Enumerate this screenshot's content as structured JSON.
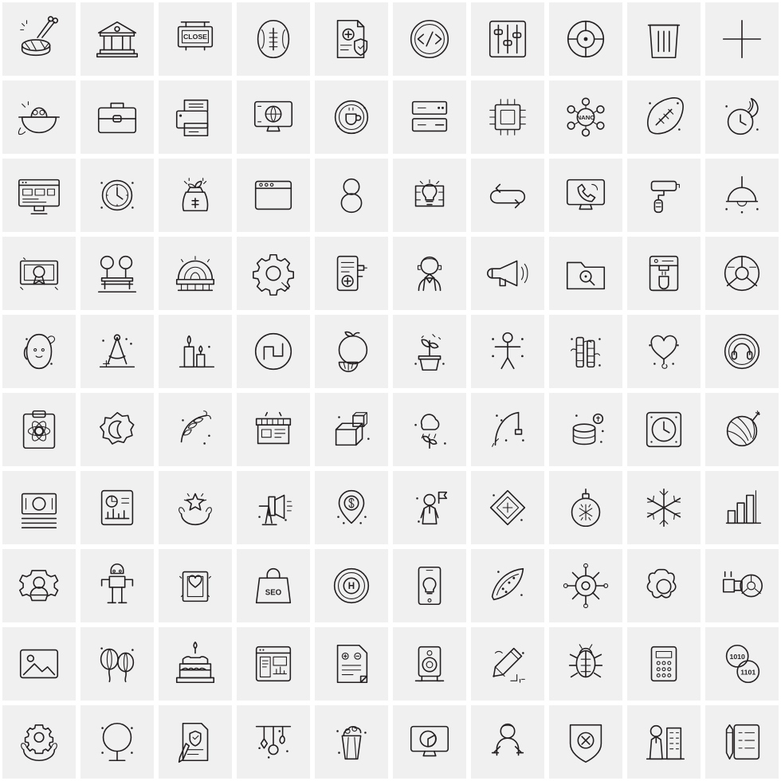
{
  "page": {
    "title": "Line Icon Set Sheet",
    "columns": 10,
    "rows": 10,
    "cell_size_px": 98,
    "icon_style": "thin line / outline",
    "stroke_color": "#231f20",
    "cell_background": "#f0f0f0",
    "sheet_background": "#ffffff"
  },
  "labels": {
    "close_sign": "CLOSE",
    "nano_molecule": "NANO",
    "seo_bag": "SEO",
    "hospital_coin": "H"
  },
  "icons": [
    {
      "row": 1,
      "col": 1,
      "name": "drum-icon",
      "label": "Drum"
    },
    {
      "row": 1,
      "col": 2,
      "name": "bank-building-icon",
      "label": "Bank Building"
    },
    {
      "row": 1,
      "col": 3,
      "name": "close-sign-icon",
      "label": "Close Sign"
    },
    {
      "row": 1,
      "col": 4,
      "name": "american-football-icon",
      "label": "American Football"
    },
    {
      "row": 1,
      "col": 5,
      "name": "medical-report-shield-icon",
      "label": "Medical Report"
    },
    {
      "row": 1,
      "col": 6,
      "name": "code-circle-icon",
      "label": "Coding"
    },
    {
      "row": 1,
      "col": 7,
      "name": "settings-sliders-icon",
      "label": "Settings Sliders"
    },
    {
      "row": 1,
      "col": 8,
      "name": "target-icon",
      "label": "Target"
    },
    {
      "row": 1,
      "col": 9,
      "name": "trash-bin-icon",
      "label": "Trash Bin"
    },
    {
      "row": 1,
      "col": 10,
      "name": "plus-icon",
      "label": "Plus"
    },
    {
      "row": 2,
      "col": 1,
      "name": "rice-bowl-icon",
      "label": "Rice Bowl"
    },
    {
      "row": 2,
      "col": 2,
      "name": "briefcase-icon",
      "label": "Briefcase"
    },
    {
      "row": 2,
      "col": 3,
      "name": "printer-icon",
      "label": "Printer"
    },
    {
      "row": 2,
      "col": 4,
      "name": "monitor-globe-icon",
      "label": "Global Monitor"
    },
    {
      "row": 2,
      "col": 5,
      "name": "coffee-badge-icon",
      "label": "Coffee Badge"
    },
    {
      "row": 2,
      "col": 6,
      "name": "server-remove-icon",
      "label": "Remove Server"
    },
    {
      "row": 2,
      "col": 7,
      "name": "microchip-icon",
      "label": "Microchip"
    },
    {
      "row": 2,
      "col": 8,
      "name": "nano-molecule-icon",
      "label": "Nano Molecule"
    },
    {
      "row": 2,
      "col": 9,
      "name": "rugby-ball-icon",
      "label": "Rugby Ball"
    },
    {
      "row": 2,
      "col": 10,
      "name": "fire-clock-icon",
      "label": "Burning Clock"
    },
    {
      "row": 3,
      "col": 1,
      "name": "desktop-layout-icon",
      "label": "Desktop Layout"
    },
    {
      "row": 3,
      "col": 2,
      "name": "wall-clock-icon",
      "label": "Wall Clock"
    },
    {
      "row": 3,
      "col": 3,
      "name": "money-plant-bag-icon",
      "label": "Money Growth Bag"
    },
    {
      "row": 3,
      "col": 4,
      "name": "browser-window-icon",
      "label": "Browser Window"
    },
    {
      "row": 3,
      "col": 5,
      "name": "number-eight-icon",
      "label": "Number Eight"
    },
    {
      "row": 3,
      "col": 6,
      "name": "idea-bulb-map-icon",
      "label": "Idea Location"
    },
    {
      "row": 3,
      "col": 7,
      "name": "refresh-loop-icon",
      "label": "Refresh Loop"
    },
    {
      "row": 3,
      "col": 8,
      "name": "monitor-call-icon",
      "label": "Online Call"
    },
    {
      "row": 3,
      "col": 9,
      "name": "paint-roller-icon",
      "label": "Paint Roller"
    },
    {
      "row": 3,
      "col": 10,
      "name": "hanging-lamp-icon",
      "label": "Hanging Lamp"
    },
    {
      "row": 4,
      "col": 1,
      "name": "certificate-award-icon",
      "label": "Certificate Award"
    },
    {
      "row": 4,
      "col": 2,
      "name": "park-bench-icon",
      "label": "Park Bench"
    },
    {
      "row": 4,
      "col": 3,
      "name": "stadium-icon",
      "label": "Stadium"
    },
    {
      "row": 4,
      "col": 4,
      "name": "gear-settings-icon",
      "label": "Gear Settings"
    },
    {
      "row": 4,
      "col": 5,
      "name": "medical-device-icon",
      "label": "Medical Device"
    },
    {
      "row": 4,
      "col": 6,
      "name": "support-agent-icon",
      "label": "Support Agent"
    },
    {
      "row": 4,
      "col": 7,
      "name": "megaphone-icon",
      "label": "Megaphone"
    },
    {
      "row": 4,
      "col": 8,
      "name": "folder-search-icon",
      "label": "Search Folder"
    },
    {
      "row": 4,
      "col": 9,
      "name": "coffee-machine-icon",
      "label": "Coffee Machine"
    },
    {
      "row": 4,
      "col": 10,
      "name": "steering-wheel-icon",
      "label": "Steering Wheel"
    },
    {
      "row": 5,
      "col": 1,
      "name": "baby-sling-icon",
      "label": "Baby Carrier"
    },
    {
      "row": 5,
      "col": 2,
      "name": "drafting-compass-icon",
      "label": "Drafting Compass"
    },
    {
      "row": 5,
      "col": 3,
      "name": "candle-icon",
      "label": "Candle"
    },
    {
      "row": 5,
      "col": 4,
      "name": "square-wave-circle-icon",
      "label": "Square Wave"
    },
    {
      "row": 5,
      "col": 5,
      "name": "orange-fruit-icon",
      "label": "Orange Fruit"
    },
    {
      "row": 5,
      "col": 6,
      "name": "potted-plant-icon",
      "label": "Potted Plant"
    },
    {
      "row": 5,
      "col": 7,
      "name": "body-stretch-icon",
      "label": "Body Stretch"
    },
    {
      "row": 5,
      "col": 8,
      "name": "bamboo-icon",
      "label": "Bamboo"
    },
    {
      "row": 5,
      "col": 9,
      "name": "heart-balloon-icon",
      "label": "Heart Balloon"
    },
    {
      "row": 5,
      "col": 10,
      "name": "headphone-coin-icon",
      "label": "Headphone Badge"
    },
    {
      "row": 6,
      "col": 1,
      "name": "clipboard-atom-icon",
      "label": "Science Clipboard"
    },
    {
      "row": 6,
      "col": 2,
      "name": "crescent-moon-badge-icon",
      "label": "Crescent Badge"
    },
    {
      "row": 6,
      "col": 3,
      "name": "wheat-leaf-icon",
      "label": "Wheat Leaf"
    },
    {
      "row": 6,
      "col": 4,
      "name": "store-front-icon",
      "label": "Store Front"
    },
    {
      "row": 6,
      "col": 5,
      "name": "package-box-icon",
      "label": "Package Box"
    },
    {
      "row": 6,
      "col": 6,
      "name": "rain-cloud-plant-icon",
      "label": "Rain Growth"
    },
    {
      "row": 6,
      "col": 7,
      "name": "fishing-rod-icon",
      "label": "Fishing Rod"
    },
    {
      "row": 6,
      "col": 8,
      "name": "money-coins-icon",
      "label": "Money Coins"
    },
    {
      "row": 6,
      "col": 9,
      "name": "wall-clock-square-icon",
      "label": "Square Clock"
    },
    {
      "row": 6,
      "col": 10,
      "name": "yarn-ball-icon",
      "label": "Yarn Ball"
    },
    {
      "row": 7,
      "col": 1,
      "name": "banknote-icon",
      "label": "Banknote"
    },
    {
      "row": 7,
      "col": 2,
      "name": "report-chart-icon",
      "label": "Report Chart"
    },
    {
      "row": 7,
      "col": 3,
      "name": "hands-star-icon",
      "label": "Service Quality"
    },
    {
      "row": 7,
      "col": 4,
      "name": "studio-light-icon",
      "label": "Studio Light"
    },
    {
      "row": 7,
      "col": 5,
      "name": "dollar-location-icon",
      "label": "Money Location"
    },
    {
      "row": 7,
      "col": 6,
      "name": "businessman-flag-icon",
      "label": "Leadership"
    },
    {
      "row": 7,
      "col": 7,
      "name": "ticket-icon",
      "label": "Ticket"
    },
    {
      "row": 7,
      "col": 8,
      "name": "christmas-ball-icon",
      "label": "Christmas Ball"
    },
    {
      "row": 7,
      "col": 9,
      "name": "snowflake-icon",
      "label": "Snowflake"
    },
    {
      "row": 7,
      "col": 10,
      "name": "bar-chart-icon",
      "label": "Bar Chart"
    },
    {
      "row": 8,
      "col": 1,
      "name": "user-settings-gear-icon",
      "label": "User Settings"
    },
    {
      "row": 8,
      "col": 2,
      "name": "athlete-icon",
      "label": "Athlete"
    },
    {
      "row": 8,
      "col": 3,
      "name": "picture-frame-icon",
      "label": "Picture Frame"
    },
    {
      "row": 8,
      "col": 4,
      "name": "seo-shopping-bag-icon",
      "label": "SEO Bag"
    },
    {
      "row": 8,
      "col": 5,
      "name": "hospital-coin-icon",
      "label": "Hospital Coin"
    },
    {
      "row": 8,
      "col": 6,
      "name": "mobile-idea-icon",
      "label": "Mobile Idea"
    },
    {
      "row": 8,
      "col": 7,
      "name": "watermelon-slice-icon",
      "label": "Watermelon Slice"
    },
    {
      "row": 8,
      "col": 8,
      "name": "ship-helm-icon",
      "label": "Ship Helm"
    },
    {
      "row": 8,
      "col": 9,
      "name": "flower-badge-icon",
      "label": "Flower Badge"
    },
    {
      "row": 8,
      "col": 10,
      "name": "pipe-valve-icon",
      "label": "Pipe Valve"
    },
    {
      "row": 9,
      "col": 1,
      "name": "image-photo-icon",
      "label": "Photo"
    },
    {
      "row": 9,
      "col": 2,
      "name": "balloons-icon",
      "label": "Balloons"
    },
    {
      "row": 9,
      "col": 3,
      "name": "birthday-cake-icon",
      "label": "Birthday Cake"
    },
    {
      "row": 9,
      "col": 4,
      "name": "web-dashboard-icon",
      "label": "Web Dashboard"
    },
    {
      "row": 9,
      "col": 5,
      "name": "document-edit-icon",
      "label": "Edit Document"
    },
    {
      "row": 9,
      "col": 6,
      "name": "speaker-icon",
      "label": "Speaker"
    },
    {
      "row": 9,
      "col": 7,
      "name": "pencil-draw-icon",
      "label": "Pencil Draw"
    },
    {
      "row": 9,
      "col": 8,
      "name": "bug-icon",
      "label": "Bug"
    },
    {
      "row": 9,
      "col": 9,
      "name": "office-phone-icon",
      "label": "Office Phone"
    },
    {
      "row": 9,
      "col": 10,
      "name": "binary-data-circles-icon",
      "label": "Binary Data"
    },
    {
      "row": 10,
      "col": 1,
      "name": "hands-gear-icon",
      "label": "Support Gear"
    },
    {
      "row": 10,
      "col": 2,
      "name": "tree-icon",
      "label": "Tree"
    },
    {
      "row": 10,
      "col": 3,
      "name": "contract-sign-icon",
      "label": "Signed Contract"
    },
    {
      "row": 10,
      "col": 4,
      "name": "hanging-decoration-icon",
      "label": "Hanging Decoration"
    },
    {
      "row": 10,
      "col": 5,
      "name": "popcorn-icon",
      "label": "Popcorn"
    },
    {
      "row": 10,
      "col": 6,
      "name": "monitor-pie-chart-icon",
      "label": "Analytics Monitor"
    },
    {
      "row": 10,
      "col": 7,
      "name": "child-crawl-icon",
      "label": "Crawling Child"
    },
    {
      "row": 10,
      "col": 8,
      "name": "shield-cancel-icon",
      "label": "Security Denied"
    },
    {
      "row": 10,
      "col": 9,
      "name": "businessman-building-icon",
      "label": "Corporate Person"
    },
    {
      "row": 10,
      "col": 10,
      "name": "checklist-pen-icon",
      "label": "Checklist"
    }
  ]
}
